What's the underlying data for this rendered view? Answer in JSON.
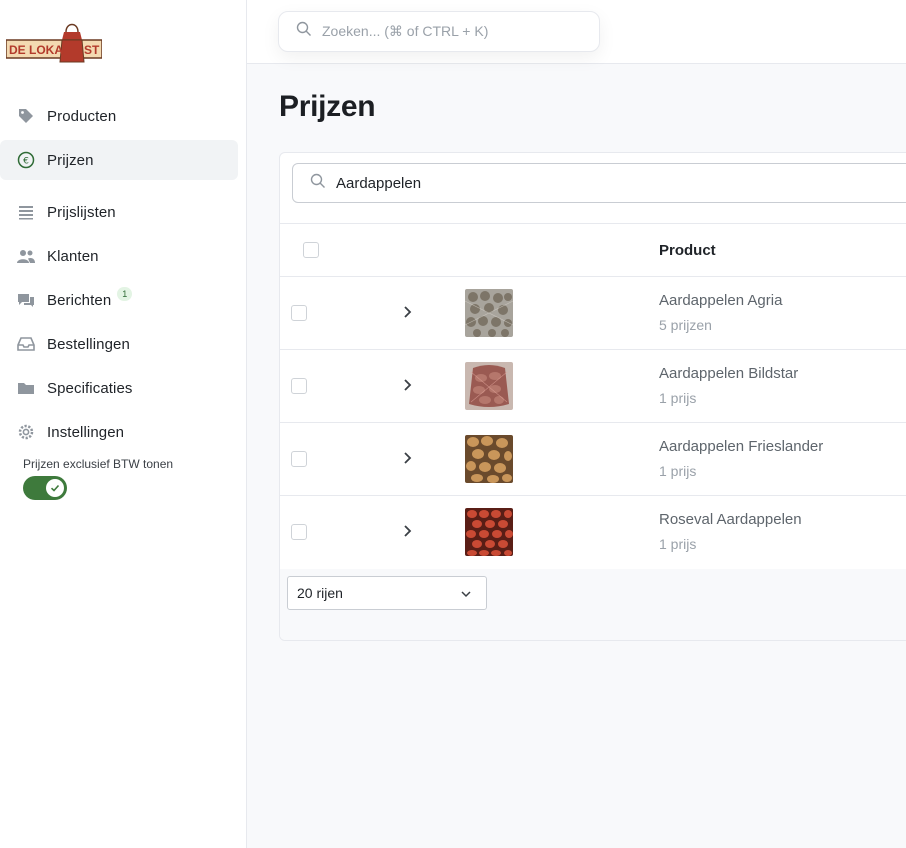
{
  "app": {
    "logo_text": "DE LOKAAL ST"
  },
  "search": {
    "placeholder": "Zoeken... (⌘ of CTRL +  K)"
  },
  "sidebar": {
    "items": [
      {
        "label": "Producten",
        "icon": "tag-icon"
      },
      {
        "label": "Prijzen",
        "icon": "euro-icon",
        "active": true
      },
      {
        "label": "Prijslijsten",
        "icon": "list-icon"
      },
      {
        "label": "Klanten",
        "icon": "users-icon"
      },
      {
        "label": "Berichten",
        "icon": "chat-icon",
        "badge": "1"
      },
      {
        "label": "Bestellingen",
        "icon": "inbox-icon"
      },
      {
        "label": "Specificaties",
        "icon": "folder-icon"
      },
      {
        "label": "Instellingen",
        "icon": "gear-icon"
      }
    ],
    "btw_toggle": {
      "label": "Prijzen exclusief BTW tonen",
      "on": true
    }
  },
  "main": {
    "title": "Prijzen",
    "table_search_value": "Aardappelen",
    "columns": {
      "product": "Product"
    },
    "rows": [
      {
        "name": "Aardappelen Agria",
        "sub": "5 prijzen"
      },
      {
        "name": "Aardappelen Bildstar",
        "sub": "1 prijs"
      },
      {
        "name": "Aardappelen Frieslander",
        "sub": "1 prijs"
      },
      {
        "name": "Roseval Aardappelen",
        "sub": "1 prijs"
      }
    ],
    "rows_per_page": "20 rijen"
  },
  "colors": {
    "accent_green": "#3e7a3c",
    "logo_red": "#b33a2b",
    "logo_cream": "#f3d9b1"
  }
}
